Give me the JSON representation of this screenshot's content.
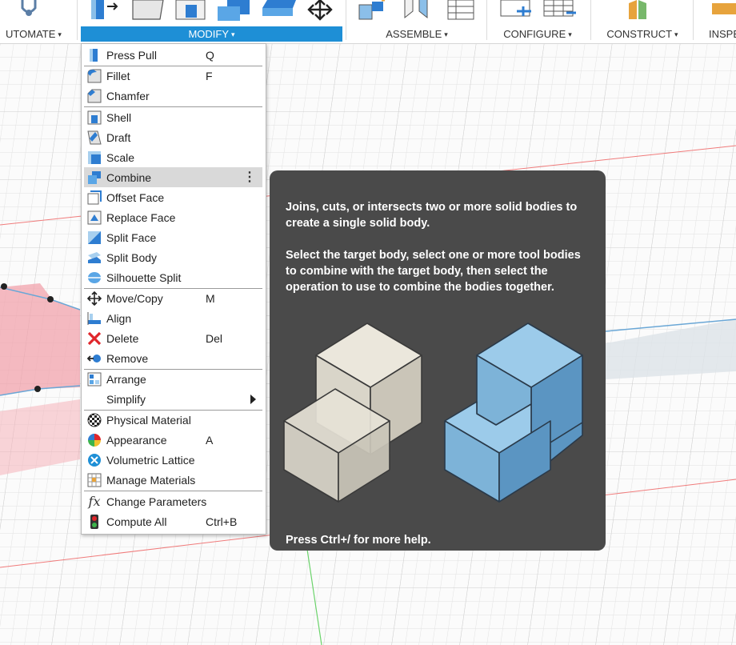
{
  "toolbar": {
    "groups": [
      {
        "label": "UTOMATE"
      },
      {
        "label": "MODIFY"
      },
      {
        "label": "ASSEMBLE"
      },
      {
        "label": "CONFIGURE"
      },
      {
        "label": "CONSTRUCT"
      },
      {
        "label": "INSPE"
      }
    ],
    "caret": "▾"
  },
  "menu": {
    "items": [
      {
        "label": "Press Pull",
        "shortcut": "Q",
        "icon": "press-pull-icon"
      },
      {
        "label": "Fillet",
        "shortcut": "F",
        "icon": "fillet-icon"
      },
      {
        "label": "Chamfer",
        "shortcut": "",
        "icon": "chamfer-icon"
      },
      {
        "label": "Shell",
        "shortcut": "",
        "icon": "shell-icon"
      },
      {
        "label": "Draft",
        "shortcut": "",
        "icon": "draft-icon"
      },
      {
        "label": "Scale",
        "shortcut": "",
        "icon": "scale-icon"
      },
      {
        "label": "Combine",
        "shortcut": "",
        "icon": "combine-icon",
        "hovered": true,
        "more": "⋮"
      },
      {
        "label": "Offset Face",
        "shortcut": "",
        "icon": "offset-face-icon"
      },
      {
        "label": "Replace Face",
        "shortcut": "",
        "icon": "replace-face-icon"
      },
      {
        "label": "Split Face",
        "shortcut": "",
        "icon": "split-face-icon"
      },
      {
        "label": "Split Body",
        "shortcut": "",
        "icon": "split-body-icon"
      },
      {
        "label": "Silhouette Split",
        "shortcut": "",
        "icon": "silhouette-split-icon"
      },
      {
        "label": "Move/Copy",
        "shortcut": "M",
        "icon": "move-copy-icon"
      },
      {
        "label": "Align",
        "shortcut": "",
        "icon": "align-icon"
      },
      {
        "label": "Delete",
        "shortcut": "Del",
        "icon": "delete-icon"
      },
      {
        "label": "Remove",
        "shortcut": "",
        "icon": "remove-icon"
      },
      {
        "label": "Arrange",
        "shortcut": "",
        "icon": "arrange-icon"
      },
      {
        "label": "Simplify",
        "shortcut": "",
        "icon": "",
        "submenu": true
      },
      {
        "label": "Physical Material",
        "shortcut": "",
        "icon": "physical-material-icon"
      },
      {
        "label": "Appearance",
        "shortcut": "A",
        "icon": "appearance-icon"
      },
      {
        "label": "Volumetric Lattice",
        "shortcut": "",
        "icon": "volumetric-lattice-icon"
      },
      {
        "label": "Manage Materials",
        "shortcut": "",
        "icon": "manage-materials-icon"
      },
      {
        "label": "Change Parameters",
        "shortcut": "",
        "icon": "change-parameters-icon"
      },
      {
        "label": "Compute All",
        "shortcut": "Ctrl+B",
        "icon": "compute-all-icon"
      }
    ]
  },
  "tooltip": {
    "description": "Joins, cuts, or intersects two or more solid bodies to create a single solid body.",
    "instructions": "Select the target body, select one or more tool bodies to combine with the target body, then select the operation to use to combine the bodies together.",
    "help": "Press Ctrl+/ for more help."
  },
  "colors": {
    "accent": "#1e8fd6",
    "tooltip_bg": "#4a4a4a",
    "illustration_before": "#d9d5c9",
    "illustration_after": "#7db3d8"
  }
}
